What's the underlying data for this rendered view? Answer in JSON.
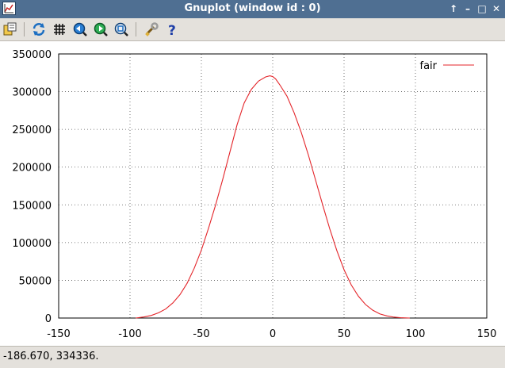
{
  "window": {
    "title": "Gnuplot (window id : 0)"
  },
  "window_controls": {
    "up": "↑",
    "minimize": "–",
    "maximize": "□",
    "close": "✕"
  },
  "toolbar": {
    "buttons": [
      {
        "name": "export-icon"
      },
      {
        "name": "replot-icon"
      },
      {
        "name": "grid-icon"
      },
      {
        "name": "zoom-previous-icon"
      },
      {
        "name": "zoom-next-icon"
      },
      {
        "name": "autoscale-icon"
      },
      {
        "name": "settings-icon"
      },
      {
        "name": "help-icon"
      }
    ]
  },
  "colors": {
    "titlebar": "#4f6f92",
    "series": "#e4262b",
    "grid": "#555555"
  },
  "status": {
    "coords": "-186.670,  334336."
  },
  "chart_data": {
    "type": "line",
    "title": "",
    "xlabel": "",
    "ylabel": "",
    "xlim": [
      -150,
      150
    ],
    "ylim": [
      0,
      350000
    ],
    "xticks": [
      -150,
      -100,
      -50,
      0,
      50,
      100,
      150
    ],
    "yticks": [
      0,
      50000,
      100000,
      150000,
      200000,
      250000,
      300000,
      350000
    ],
    "grid": true,
    "legend_position": "top-right",
    "series": [
      {
        "name": "fair",
        "color": "#e4262b",
        "x": [
          -96,
          -90,
          -85,
          -80,
          -75,
          -70,
          -65,
          -60,
          -55,
          -50,
          -45,
          -40,
          -35,
          -30,
          -25,
          -20,
          -15,
          -10,
          -5,
          -2,
          0,
          2,
          5,
          10,
          15,
          20,
          25,
          30,
          35,
          40,
          45,
          50,
          55,
          60,
          65,
          70,
          75,
          80,
          85,
          90,
          96
        ],
        "y": [
          0,
          1500,
          3500,
          7000,
          12000,
          20000,
          31000,
          46000,
          66000,
          90000,
          119000,
          150000,
          184000,
          220000,
          256000,
          285000,
          303000,
          314000,
          319500,
          321000,
          320000,
          317000,
          309000,
          294000,
          272000,
          246000,
          216000,
          183000,
          150000,
          118000,
          89000,
          64000,
          44000,
          29000,
          18000,
          10500,
          5500,
          2800,
          1200,
          400,
          0
        ]
      }
    ]
  }
}
